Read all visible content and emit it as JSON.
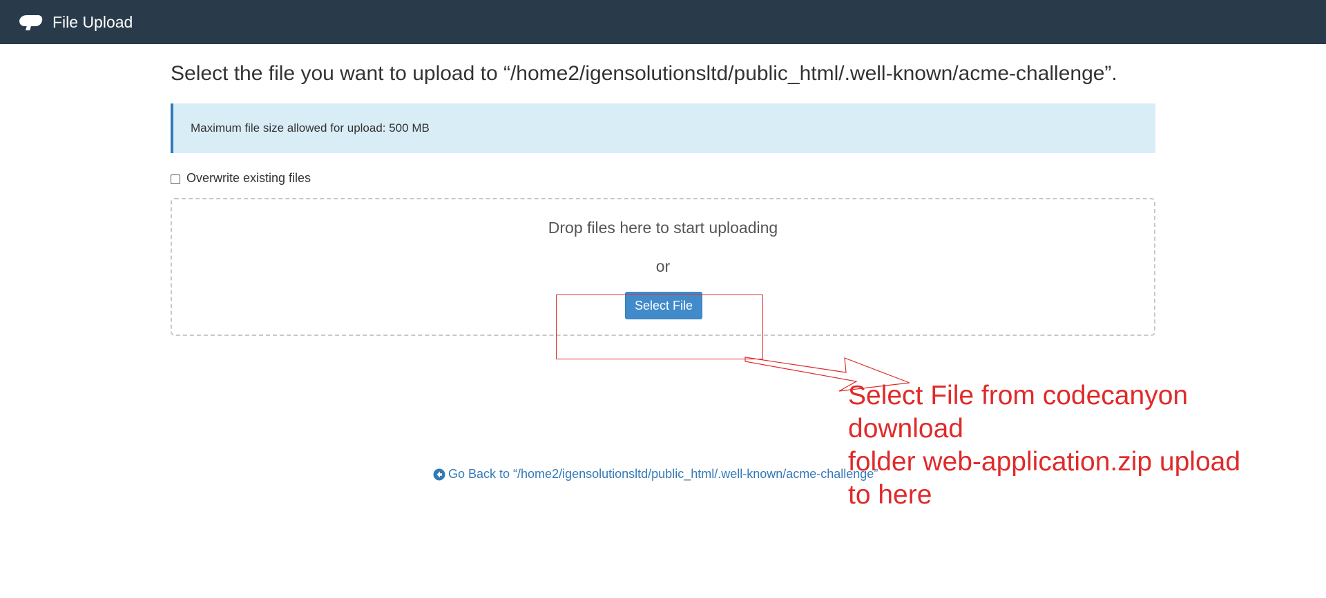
{
  "header": {
    "title": "File Upload",
    "logo_icon": "cpanel-logo-icon",
    "bg_color": "#293a4a"
  },
  "main": {
    "title": "Select the file you want to upload to “/home2/igensolutionsltd/public_html/.well-known/acme-challenge”.",
    "info_alert": "Maximum file size allowed for upload: 500 MB",
    "overwrite_label": "Overwrite existing files",
    "overwrite_checked": false,
    "dropzone": {
      "drop_text": "Drop files here to start uploading",
      "or_text": "or",
      "select_button": "Select File"
    },
    "back_link": "Go Back to “/home2/igensolutionsltd/public_html/.well-known/acme-challenge”",
    "back_icon": "arrow-circle-left-icon"
  },
  "annotation": {
    "text_line1": "Select File from codecanyon download",
    "text_line2": "folder web-application.zip upload",
    "text_line3": "to here",
    "color": "#e02a2a"
  },
  "colors": {
    "primary": "#428bca",
    "link": "#337ab7",
    "alert_bg": "#d9edf7"
  }
}
